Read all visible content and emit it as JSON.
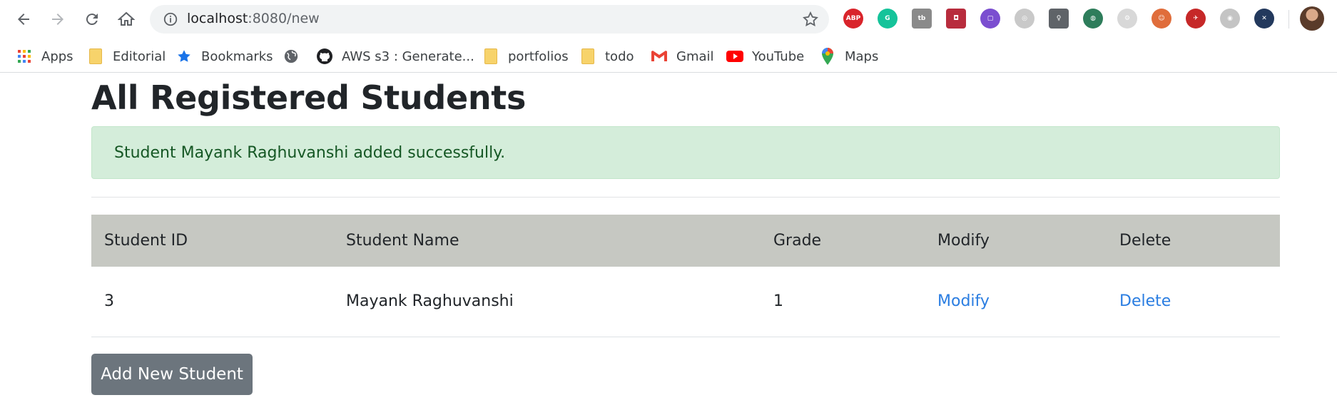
{
  "browser": {
    "url_host": "localhost",
    "url_path": ":8080/new",
    "extensions": [
      {
        "name": "adblock-plus-icon",
        "label": "ABP",
        "color": "#d9242b"
      },
      {
        "name": "grammarly-icon",
        "label": "G",
        "color": "#15c39a"
      },
      {
        "name": "tb-icon",
        "label": "tb",
        "color": "#8a8a8a"
      },
      {
        "name": "pocket-icon",
        "label": "◘",
        "color": "#b82c3d"
      },
      {
        "name": "markup-icon",
        "label": "▢",
        "color": "#7b4ed0"
      },
      {
        "name": "circle-ext-icon",
        "label": "◎",
        "color": "#c9c9c9"
      },
      {
        "name": "keep-icon",
        "label": "♀",
        "color": "#5f6368"
      },
      {
        "name": "globe-ext-icon",
        "label": "◍",
        "color": "#2e7d5b"
      },
      {
        "name": "grey-ext-icon",
        "label": "⚙",
        "color": "#d8d8d8"
      },
      {
        "name": "face-ext-icon",
        "label": "☺",
        "color": "#e06d3b"
      },
      {
        "name": "red-ext-icon",
        "label": "✈",
        "color": "#c62828"
      },
      {
        "name": "cam-ext-icon",
        "label": "◉",
        "color": "#c4c4c4"
      },
      {
        "name": "dark-ext-icon",
        "label": "✕",
        "color": "#23395d"
      }
    ]
  },
  "bookmarks": [
    {
      "name": "bookmark-apps",
      "label": "Apps",
      "icon": "apps-grid-icon"
    },
    {
      "name": "bookmark-editorial",
      "label": "Editorial",
      "icon": "folder-icon"
    },
    {
      "name": "bookmark-bookmarks",
      "label": "Bookmarks",
      "icon": "star-icon"
    },
    {
      "name": "bookmark-globe",
      "label": "",
      "icon": "globe-icon"
    },
    {
      "name": "bookmark-aws",
      "label": "AWS s3 : Generate...",
      "icon": "github-icon"
    },
    {
      "name": "bookmark-portfolios",
      "label": "portfolios",
      "icon": "folder-icon"
    },
    {
      "name": "bookmark-todo",
      "label": "todo",
      "icon": "folder-icon"
    },
    {
      "name": "bookmark-gmail",
      "label": "Gmail",
      "icon": "gmail-icon"
    },
    {
      "name": "bookmark-youtube",
      "label": "YouTube",
      "icon": "youtube-icon"
    },
    {
      "name": "bookmark-maps",
      "label": "Maps",
      "icon": "maps-icon"
    }
  ],
  "page": {
    "title": "All Registered Students",
    "alert": "Student Mayank Raghuvanshi added successfully.",
    "table": {
      "headers": [
        "Student ID",
        "Student Name",
        "Grade",
        "Modify",
        "Delete"
      ],
      "rows": [
        {
          "id": "3",
          "name": "Mayank Raghuvanshi",
          "grade": "1",
          "modify": "Modify",
          "delete": "Delete"
        }
      ]
    },
    "add_button": "Add New Student"
  },
  "colors": {
    "alert_bg": "#d4edda",
    "alert_text": "#155724",
    "table_header_bg": "#c6c8c2",
    "link": "#2a7de1",
    "button_bg": "#6c757d"
  }
}
